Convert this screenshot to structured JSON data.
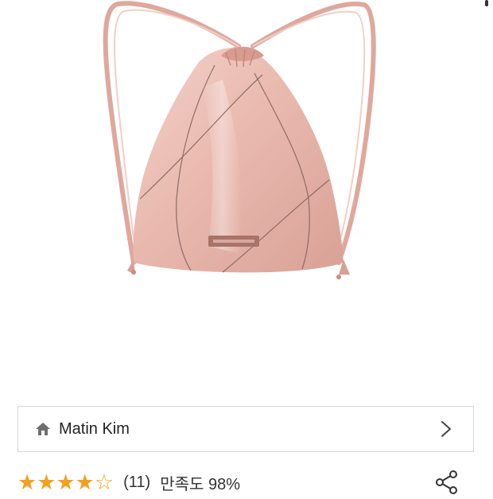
{
  "product": {
    "image_alt": "Pink drawstring backpack",
    "colors": {
      "bag": "#e7b7ad",
      "bag_shadow": "#cf978c",
      "bag_highlight": "#f6d9d2",
      "seam": "#8f6b66"
    }
  },
  "brand": {
    "name": "Matin Kim",
    "icon": "home-icon"
  },
  "rating": {
    "stars_total": 5,
    "stars_filled": 4,
    "star_color": "#f3a01e",
    "review_count": "(11)",
    "satisfaction_label": "만족도 98%"
  },
  "actions": {
    "share_icon": "share-icon"
  }
}
